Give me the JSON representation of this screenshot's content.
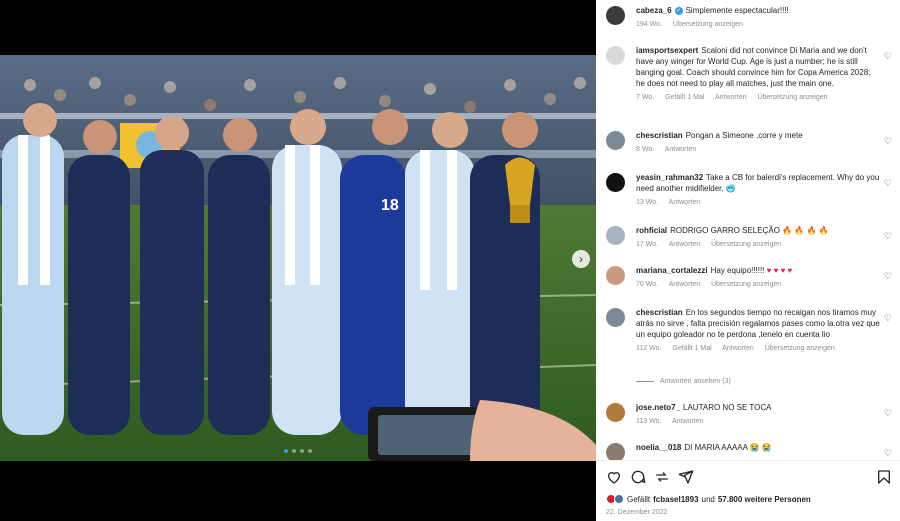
{
  "post": {
    "photo_alt": "Argentinian coaching staff with World Cup trophy",
    "banner_player_number": "18",
    "carousel": {
      "count": 4,
      "active": 0
    }
  },
  "comments": [
    {
      "user": "cabeza_6",
      "verified": true,
      "text": "Simplemente espectacular!!!!",
      "age": "194 Wo.",
      "links": [
        "Übersetzung anzeigen"
      ]
    },
    {
      "user": "iamsportsexpert",
      "text": "Scaloni did not convince Di Maria and we don't have any winger for World Cup. Age is just a number; he is still banging goal. Coach should convince him for Copa America 2028; he does not need to play all matches, just the main one.",
      "age": "7 Wo.",
      "links": [
        "Gefällt 1 Mal",
        "Antworten",
        "Übersetzung anzeigen"
      ]
    },
    {
      "user": "chescristian",
      "text": "Pongan a Simeone ,corre y mete",
      "age": "8 Wo.",
      "links": [
        "Antworten"
      ]
    },
    {
      "user": "yeasin_rahman32",
      "text": "Take a CB for balerdi's replacement. Why do you need another midifielder.",
      "emoji": "🥶",
      "age": "13 Wo.",
      "links": [
        "Antworten"
      ]
    },
    {
      "user": "rohficial",
      "text": "RODRIGO GARRO SELEÇÃO",
      "emoji": "🔥 🔥 🔥 🔥",
      "age": "17 Wo.",
      "links": [
        "Antworten",
        "Übersetzung anzeigen"
      ]
    },
    {
      "user": "mariana_cortalezzi",
      "text": "Hay equipo!!!!!!",
      "emoji": "♥ ♥ ♥ ♥",
      "age": "70 Wo.",
      "links": [
        "Antworten",
        "Übersetzung anzeigen"
      ]
    },
    {
      "user": "chescristian",
      "text": "En los segundos tiempo no recaigan nos tiramos muy atrás no sirve , falta precisión regalamos pases como la.otra vez que un equipo goleador no te perdona ,tenelo en cuenta lio",
      "age": "112 Wo.",
      "links": [
        "Gefällt 1 Mal",
        "Antworten",
        "Übersetzung anzeigen"
      ]
    },
    {
      "user": "jose.neto7_",
      "text": "LAUTARO NO SE TOCA",
      "age": "113 Wo.",
      "links": [
        "Antworten"
      ]
    },
    {
      "user": "noelia__018",
      "text": "DI MARIA AAAAA",
      "emoji": "😭 😭",
      "age": "",
      "links": []
    }
  ],
  "replies_link": "Antworten ansehen (3)",
  "likes": {
    "prefix": "Gefällt",
    "user": "fcbasel1893",
    "middle": "und",
    "count": "57.800 weitere Personen"
  },
  "date": "22. Dezember 2022",
  "colors": {
    "verified": "#3897f0",
    "meta": "#8e8e8e",
    "heart_emoji": "#e0245e"
  },
  "icons": {
    "like": "heart-outline-icon",
    "comment": "comment-bubble-icon",
    "share": "send-icon",
    "save": "bookmark-icon"
  }
}
